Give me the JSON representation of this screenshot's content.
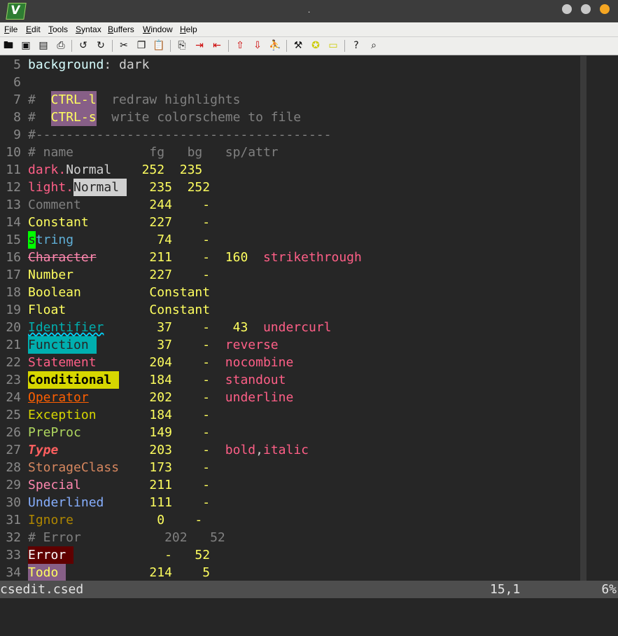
{
  "window": {
    "title": "."
  },
  "menu": [
    "File",
    "Edit",
    "Tools",
    "Syntax",
    "Buffers",
    "Window",
    "Help"
  ],
  "toolbar_icons": [
    "open-icon",
    "save-icon",
    "save-all-icon",
    "print-icon",
    "undo-icon",
    "redo-icon",
    "cut-icon",
    "copy-icon",
    "paste-icon",
    "find-replace-icon",
    "find-next-icon",
    "find-prev-icon",
    "load-session-icon",
    "save-session-icon",
    "run-script-icon",
    "make-icon",
    "run-ctags-icon",
    "jump-tag-icon",
    "help-icon",
    "find-help-icon"
  ],
  "lines": [
    {
      "n": "5",
      "segs": [
        {
          "t": "background",
          "c": "#d7ffff"
        },
        {
          "t": ": ",
          "c": "#d0d0d0"
        },
        {
          "t": "dark",
          "c": "#d0d0d0"
        }
      ]
    },
    {
      "n": "6",
      "segs": []
    },
    {
      "n": "7",
      "segs": [
        {
          "t": "#  ",
          "c": "#808080"
        },
        {
          "t": "CTRL-l",
          "c": "#ffff5f",
          "bg": "#875f87"
        },
        {
          "t": "  redraw highlights",
          "c": "#808080"
        }
      ]
    },
    {
      "n": "8",
      "segs": [
        {
          "t": "#  ",
          "c": "#808080"
        },
        {
          "t": "CTRL-s",
          "c": "#ffff5f",
          "bg": "#875f87"
        },
        {
          "t": "  write colorscheme to file",
          "c": "#808080"
        }
      ]
    },
    {
      "n": "9",
      "segs": [
        {
          "t": "#---------------------------------------",
          "c": "#808080"
        }
      ]
    },
    {
      "n": "10",
      "segs": [
        {
          "t": "# name          fg   bg   sp/attr",
          "c": "#808080"
        }
      ]
    },
    {
      "n": "11",
      "segs": [
        {
          "t": "dark.",
          "c": "#ff5f87"
        },
        {
          "t": "Normal",
          "c": "#d0d0d0"
        },
        {
          "t": "    ",
          "c": "#d0d0d0"
        },
        {
          "t": "252  235",
          "c": "#ffff5f"
        }
      ]
    },
    {
      "n": "12",
      "segs": [
        {
          "t": "light.",
          "c": "#ff5f87"
        },
        {
          "t": "Normal ",
          "c": "#262626",
          "bg": "#d0d0d0"
        },
        {
          "t": "   ",
          "c": "#d0d0d0"
        },
        {
          "t": "235  252",
          "c": "#ffff5f"
        }
      ]
    },
    {
      "n": "13",
      "segs": [
        {
          "t": "Comment",
          "c": "#808080"
        },
        {
          "t": "         ",
          "c": "#d0d0d0"
        },
        {
          "t": "244    -",
          "c": "#ffff5f"
        }
      ]
    },
    {
      "n": "14",
      "segs": [
        {
          "t": "Constant",
          "c": "#ffff5f"
        },
        {
          "t": "        ",
          "c": "#d0d0d0"
        },
        {
          "t": "227    -",
          "c": "#ffff5f"
        }
      ]
    },
    {
      "n": "15",
      "segs": [
        {
          "t": "s",
          "c": "#262626",
          "bg": "#00ff00"
        },
        {
          "t": "tring",
          "c": "#5fafd7"
        },
        {
          "t": "           ",
          "c": "#d0d0d0"
        },
        {
          "t": "74    -",
          "c": "#ffff5f"
        }
      ]
    },
    {
      "n": "16",
      "segs": [
        {
          "t": "Character",
          "c": "#ff87af",
          "deco": "line-through"
        },
        {
          "t": "       ",
          "c": "#d0d0d0"
        },
        {
          "t": "211    -  160",
          "c": "#ffff5f"
        },
        {
          "t": "  strikethrough",
          "c": "#ff5f87"
        }
      ]
    },
    {
      "n": "17",
      "segs": [
        {
          "t": "Number",
          "c": "#ffff5f"
        },
        {
          "t": "          ",
          "c": "#d0d0d0"
        },
        {
          "t": "227    -",
          "c": "#ffff5f"
        }
      ]
    },
    {
      "n": "18",
      "segs": [
        {
          "t": "Boolean",
          "c": "#ffff5f"
        },
        {
          "t": "         ",
          "c": "#d0d0d0"
        },
        {
          "t": "Constant",
          "c": "#ffff5f"
        }
      ]
    },
    {
      "n": "19",
      "segs": [
        {
          "t": "Float",
          "c": "#ffff5f"
        },
        {
          "t": "           ",
          "c": "#d0d0d0"
        },
        {
          "t": "Constant",
          "c": "#ffff5f"
        }
      ]
    },
    {
      "n": "20",
      "segs": [
        {
          "t": "Identifier",
          "c": "#00afaf",
          "deco": "underline wavy #00d7ff"
        },
        {
          "t": "       ",
          "c": "#d0d0d0"
        },
        {
          "t": "37    -   43",
          "c": "#ffff5f"
        },
        {
          "t": "  undercurl",
          "c": "#ff5f87"
        }
      ]
    },
    {
      "n": "21",
      "segs": [
        {
          "t": "Function ",
          "c": "#262626",
          "bg": "#00afaf"
        },
        {
          "t": "        ",
          "c": "#d0d0d0"
        },
        {
          "t": "37    -",
          "c": "#ffff5f"
        },
        {
          "t": "  reverse",
          "c": "#ff5f87"
        }
      ]
    },
    {
      "n": "22",
      "segs": [
        {
          "t": "Statement",
          "c": "#ff5f87"
        },
        {
          "t": "       ",
          "c": "#d0d0d0"
        },
        {
          "t": "204    -",
          "c": "#ffff5f"
        },
        {
          "t": "  nocombine",
          "c": "#ff5f87"
        }
      ]
    },
    {
      "n": "23",
      "segs": [
        {
          "t": "Conditional ",
          "c": "#000000",
          "bg": "#d7d700",
          "bold": true
        },
        {
          "t": "    ",
          "c": "#d0d0d0"
        },
        {
          "t": "184    -",
          "c": "#ffff5f"
        },
        {
          "t": "  standout",
          "c": "#ff5f87"
        }
      ]
    },
    {
      "n": "24",
      "segs": [
        {
          "t": "Operator",
          "c": "#ff5f00",
          "deco": "underline"
        },
        {
          "t": "        ",
          "c": "#d0d0d0"
        },
        {
          "t": "202    -",
          "c": "#ffff5f"
        },
        {
          "t": "  underline",
          "c": "#ff5f87"
        }
      ]
    },
    {
      "n": "25",
      "segs": [
        {
          "t": "Exception",
          "c": "#d7d700"
        },
        {
          "t": "       ",
          "c": "#d0d0d0"
        },
        {
          "t": "184    -",
          "c": "#ffff5f"
        }
      ]
    },
    {
      "n": "26",
      "segs": [
        {
          "t": "PreProc",
          "c": "#afd75f"
        },
        {
          "t": "         ",
          "c": "#d0d0d0"
        },
        {
          "t": "149    -",
          "c": "#ffff5f"
        }
      ]
    },
    {
      "n": "27",
      "segs": [
        {
          "t": "Type",
          "c": "#ff5f5f",
          "bold": true,
          "italic": true
        },
        {
          "t": "            ",
          "c": "#d0d0d0"
        },
        {
          "t": "203    -",
          "c": "#ffff5f"
        },
        {
          "t": "  bold",
          "c": "#ff5f87"
        },
        {
          "t": ",",
          "c": "#d0d0d0"
        },
        {
          "t": "italic",
          "c": "#ff5f87"
        }
      ]
    },
    {
      "n": "28",
      "segs": [
        {
          "t": "StorageClass",
          "c": "#d7875f"
        },
        {
          "t": "    ",
          "c": "#d0d0d0"
        },
        {
          "t": "173    -",
          "c": "#ffff5f"
        }
      ]
    },
    {
      "n": "29",
      "segs": [
        {
          "t": "Special",
          "c": "#ff87af"
        },
        {
          "t": "         ",
          "c": "#d0d0d0"
        },
        {
          "t": "211    -",
          "c": "#ffff5f"
        }
      ]
    },
    {
      "n": "30",
      "segs": [
        {
          "t": "Underlined",
          "c": "#87afff"
        },
        {
          "t": "      ",
          "c": "#d0d0d0"
        },
        {
          "t": "111    -",
          "c": "#ffff5f"
        }
      ]
    },
    {
      "n": "31",
      "segs": [
        {
          "t": "Ignore",
          "c": "#af8700"
        },
        {
          "t": "           ",
          "c": "#d0d0d0"
        },
        {
          "t": "0    -",
          "c": "#ffff5f"
        }
      ]
    },
    {
      "n": "32",
      "segs": [
        {
          "t": "# Error           202   52",
          "c": "#808080"
        }
      ]
    },
    {
      "n": "33",
      "segs": [
        {
          "t": "Error ",
          "c": "#ffffff",
          "bg": "#5f0000"
        },
        {
          "t": "            ",
          "c": "#d0d0d0"
        },
        {
          "t": "-   52",
          "c": "#ffff5f"
        }
      ]
    },
    {
      "n": "34",
      "segs": [
        {
          "t": "Todo ",
          "c": "#ffff5f",
          "bg": "#875f87"
        },
        {
          "t": "           ",
          "c": "#d0d0d0"
        },
        {
          "t": "214    5",
          "c": "#ffff5f"
        }
      ]
    }
  ],
  "status": {
    "file": "csedit.csed",
    "pos": "15,1",
    "pct": "6%"
  }
}
